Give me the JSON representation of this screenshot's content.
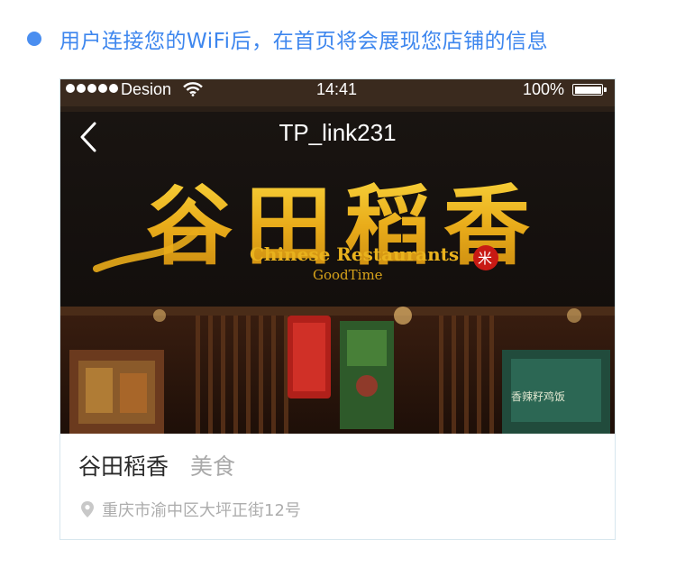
{
  "intro": {
    "text": "用户连接您的WiFi后，在首页将会展现您店铺的信息"
  },
  "status_bar": {
    "carrier": "Desion",
    "time": "14:41",
    "battery": "100%"
  },
  "nav": {
    "title": "TP_link231"
  },
  "hero_sign": {
    "logo_chars": "谷田稻香",
    "english": "Chinese Restaurants",
    "tagline": "GoodTime",
    "seal_char": "米",
    "inner_sign": "香辣籽鸡饭"
  },
  "store": {
    "name": "谷田稻香",
    "category": "美食",
    "address": "重庆市渝中区大坪正街12号"
  },
  "colors": {
    "accent": "#3d86ee",
    "gold": "#e9b21d",
    "seal_red": "#c81a14"
  },
  "icons": [
    "wifi-icon",
    "back-chevron-icon",
    "location-pin-icon",
    "battery-icon"
  ]
}
